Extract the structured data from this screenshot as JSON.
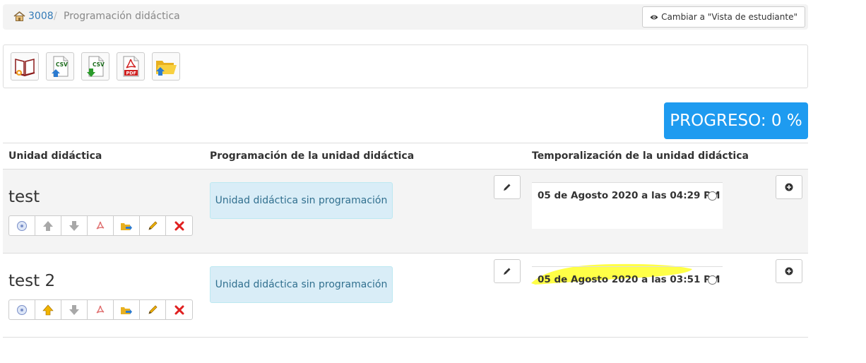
{
  "breadcrumb": {
    "home_label": "3008",
    "separator": "/",
    "current": "Programación didáctica"
  },
  "student_view_button": "Cambiar a \"Vista de estudiante\"",
  "toolbar": {
    "tools": [
      {
        "icon": "book-icon"
      },
      {
        "icon": "csv-import-icon",
        "label": "CSV"
      },
      {
        "icon": "csv-export-icon",
        "label": "CSV"
      },
      {
        "icon": "pdf-icon",
        "label": "PDF"
      },
      {
        "icon": "folder-import-icon"
      }
    ]
  },
  "progress": {
    "label": "PROGRESO: 0 %",
    "value_percent": 0,
    "color": "#1e9bf0"
  },
  "table": {
    "headers": [
      "Unidad didáctica",
      "Programación de la unidad didáctica",
      "Temporalización de la unidad didáctica"
    ],
    "rows": [
      {
        "name": "test",
        "programming": "Unidad didáctica sin programación",
        "schedule": "05 de Agosto 2020 a las 04:29 PM",
        "up_enabled": false
      },
      {
        "name": "test 2",
        "programming": "Unidad didáctica sin programación",
        "schedule": "05 de Agosto 2020 a las 03:51 PM",
        "up_enabled": true,
        "highlighted": true
      }
    ]
  },
  "colors": {
    "highlight": "#ffff33",
    "delete": "#e02020",
    "up_enabled": "#f0b400",
    "disabled_arrow": "#a8a8a8"
  }
}
